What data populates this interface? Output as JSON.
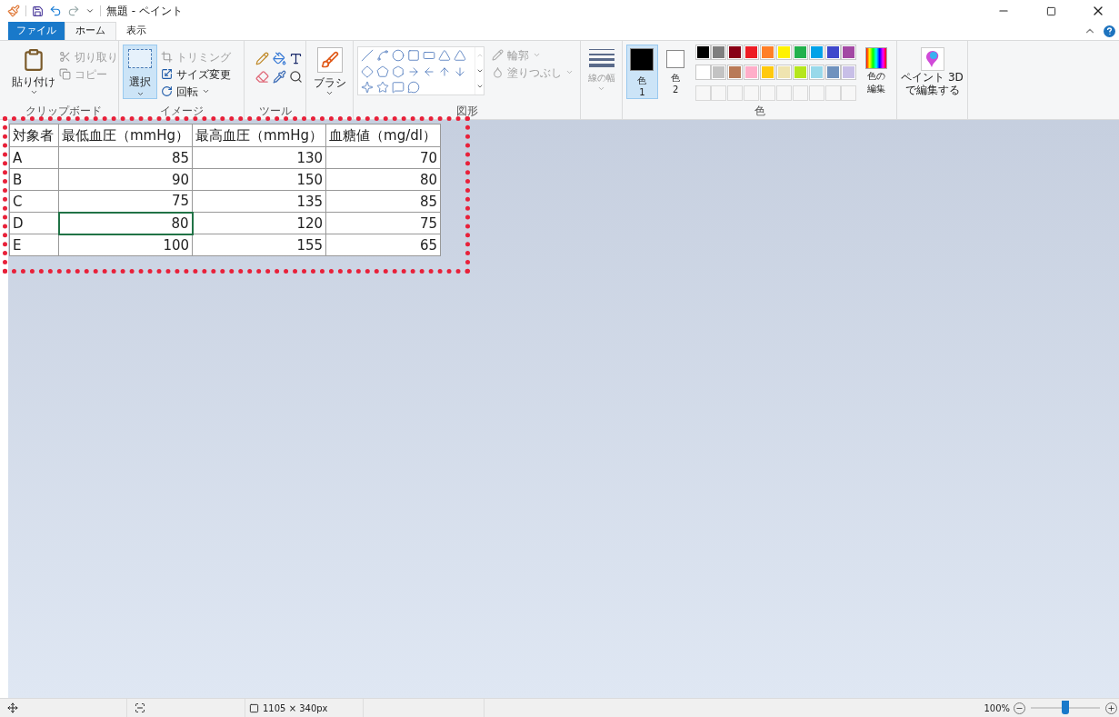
{
  "window": {
    "title": "無題 - ペイント"
  },
  "menu_tabs": [
    {
      "label": "ファイル",
      "kind": "file",
      "selected": false
    },
    {
      "label": "ホーム",
      "kind": "tab",
      "selected": true
    },
    {
      "label": "表示",
      "kind": "tab",
      "selected": false
    }
  ],
  "clipboard": {
    "label": "クリップボード",
    "paste": "貼り付け",
    "cut": {
      "label": "切り取り",
      "disabled": true
    },
    "copy": {
      "label": "コピー",
      "disabled": true
    }
  },
  "image": {
    "label": "イメージ",
    "select": {
      "label": "選択",
      "selected": true
    },
    "trim": {
      "label": "トリミング",
      "disabled": true
    },
    "resize": {
      "label": "サイズ変更",
      "disabled": false
    },
    "rotate": {
      "label": "回転",
      "disabled": false
    }
  },
  "tools": {
    "label": "ツール"
  },
  "brush": {
    "label": "ブラシ"
  },
  "shapes": {
    "label": "図形",
    "outline": {
      "label": "輪郭",
      "disabled": true
    },
    "fill": {
      "label": "塗りつぶし",
      "disabled": true
    }
  },
  "line_width": {
    "label": "線の幅",
    "disabled": true
  },
  "colors": {
    "label": "色",
    "color1": {
      "label": "色",
      "number": "1",
      "selected": true,
      "color": "#000000"
    },
    "color2": {
      "label": "色",
      "number": "2",
      "selected": false,
      "color": "#ffffff"
    },
    "palette": [
      {
        "color": "#000000"
      },
      {
        "color": "#7f7f7f"
      },
      {
        "color": "#880015"
      },
      {
        "color": "#ed1c24"
      },
      {
        "color": "#ff7f27"
      },
      {
        "color": "#fff200"
      },
      {
        "color": "#22b14c"
      },
      {
        "color": "#00a2e8"
      },
      {
        "color": "#3f48cc"
      },
      {
        "color": "#a349a4"
      },
      {
        "color": "#ffffff"
      },
      {
        "color": "#c3c3c3"
      },
      {
        "color": "#b97a57"
      },
      {
        "color": "#ffaec9"
      },
      {
        "color": "#ffc90e"
      },
      {
        "color": "#efe4b0"
      },
      {
        "color": "#b5e61d"
      },
      {
        "color": "#99d9ea"
      },
      {
        "color": "#7092be"
      },
      {
        "color": "#c8bfe7"
      }
    ],
    "edit_colors": [
      "色の",
      "編集"
    ]
  },
  "paint3d": [
    "ペイント 3D",
    "で編集する"
  ],
  "table": {
    "columns": [
      "対象者",
      "最低血圧（mmHg）",
      "最高血圧（mmHg）",
      "血糖値（mg/dl）"
    ],
    "rows": [
      [
        {
          "text": "A",
          "selected": false
        },
        {
          "text": "85",
          "selected": false
        },
        {
          "text": "130",
          "selected": false
        },
        {
          "text": "70",
          "selected": false
        }
      ],
      [
        {
          "text": "B",
          "selected": false
        },
        {
          "text": "90",
          "selected": false
        },
        {
          "text": "150",
          "selected": false
        },
        {
          "text": "80",
          "selected": false
        }
      ],
      [
        {
          "text": "C",
          "selected": false
        },
        {
          "text": "75",
          "selected": false
        },
        {
          "text": "135",
          "selected": false
        },
        {
          "text": "85",
          "selected": false
        }
      ],
      [
        {
          "text": "D",
          "selected": false
        },
        {
          "text": "80",
          "selected": true
        },
        {
          "text": "120",
          "selected": false
        },
        {
          "text": "75",
          "selected": false
        }
      ],
      [
        {
          "text": "E",
          "selected": false
        },
        {
          "text": "100",
          "selected": false
        },
        {
          "text": "155",
          "selected": false
        },
        {
          "text": "65",
          "selected": false
        }
      ]
    ]
  },
  "status_bar": {
    "image_size": "1105 × 340px",
    "zoom": "100%",
    "zoom_slider": {
      "level": 0.5
    }
  }
}
